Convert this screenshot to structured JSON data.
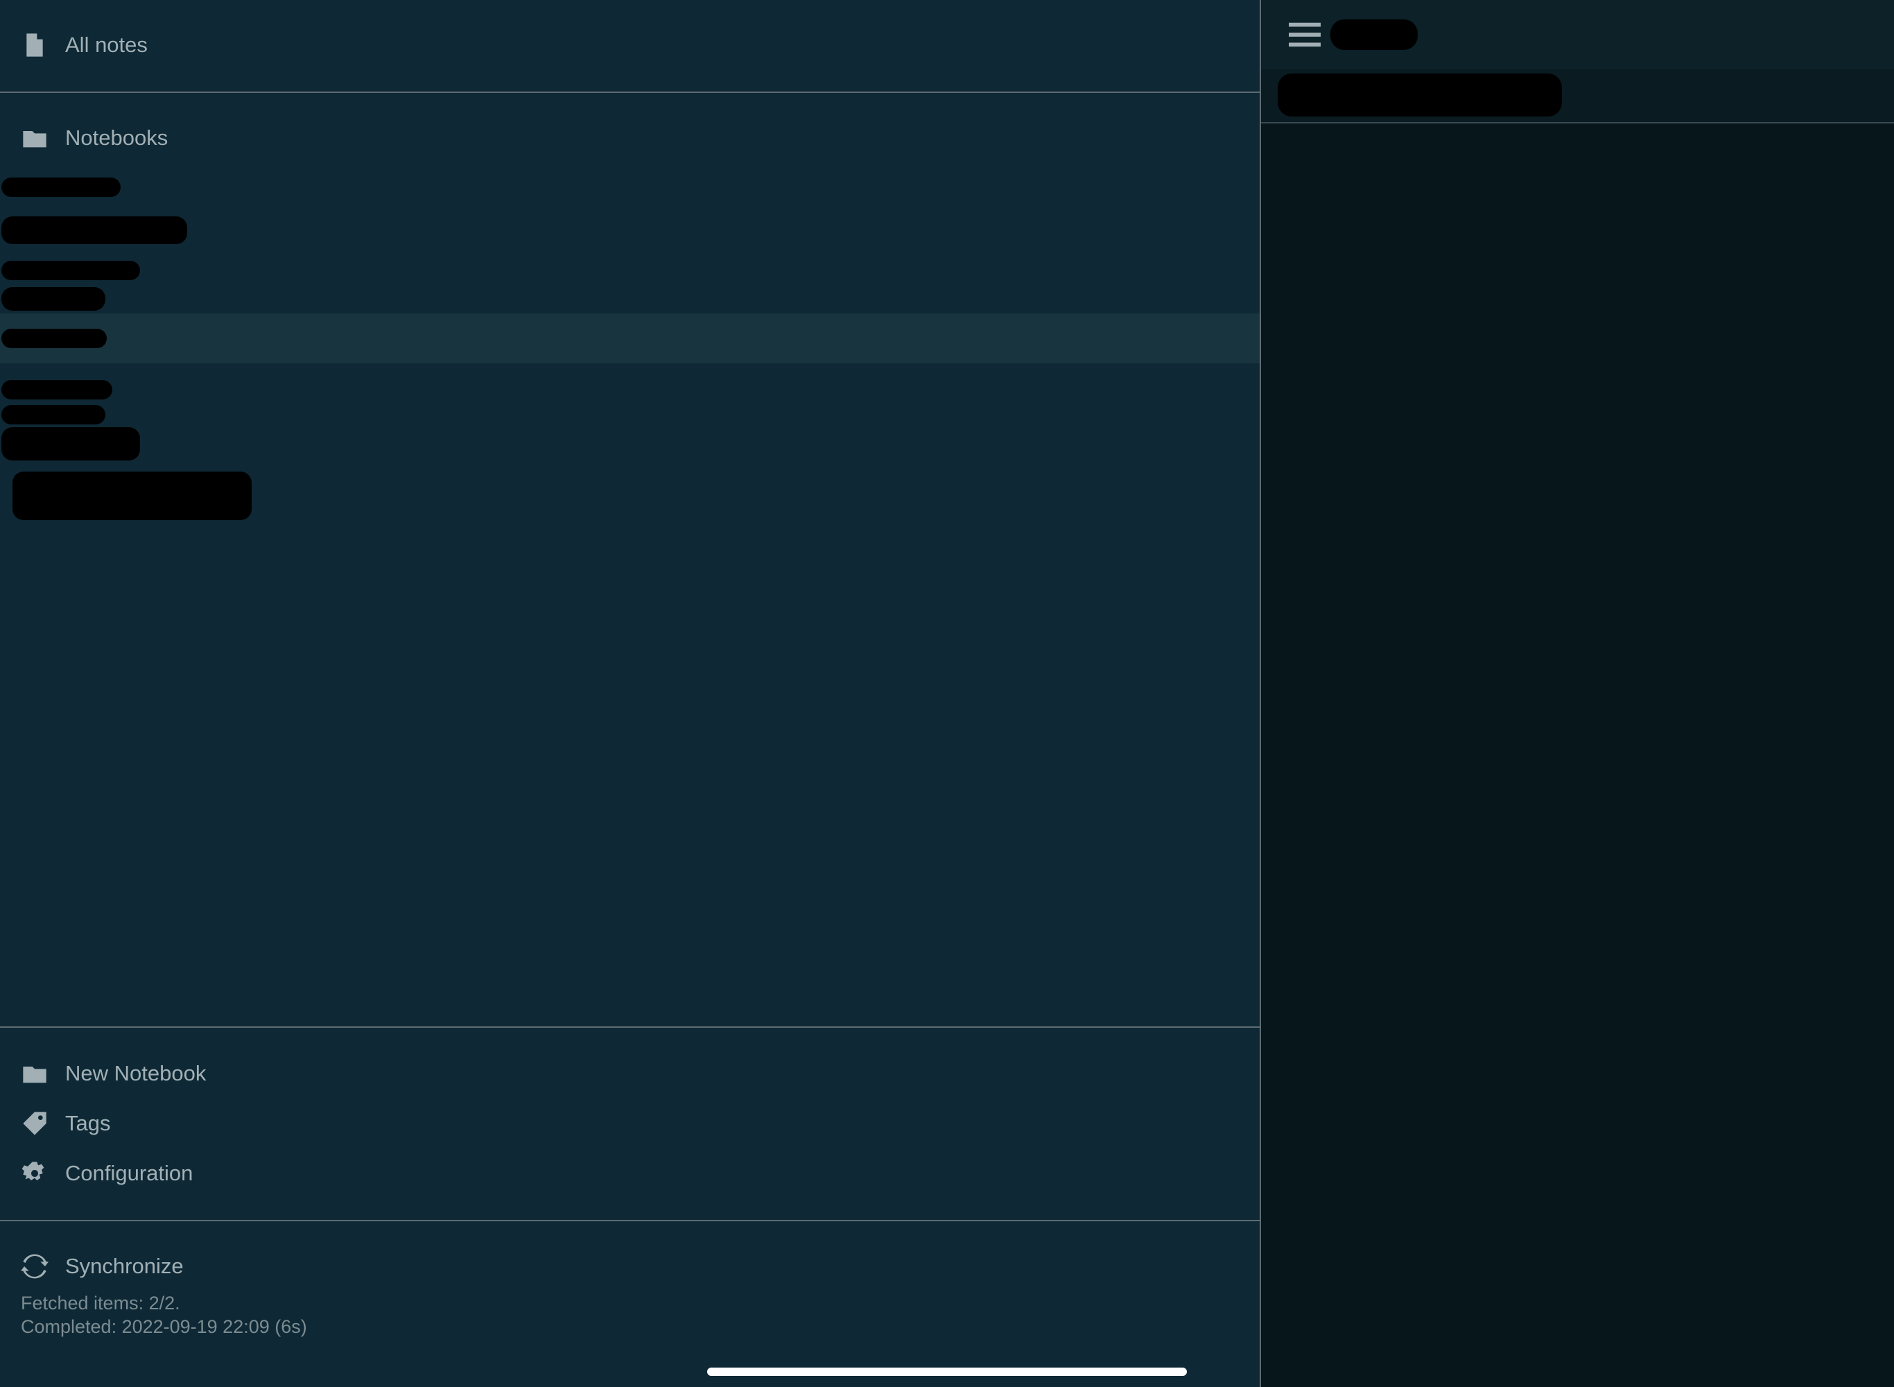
{
  "sidebar": {
    "all_notes_label": "All notes",
    "notebooks_label": "Notebooks",
    "notebook_items_count_visible": 8,
    "actions": {
      "new_notebook": "New Notebook",
      "tags": "Tags",
      "configuration": "Configuration"
    },
    "sync": {
      "label": "Synchronize",
      "fetched": "Fetched items: 2/2.",
      "completed": "Completed: 2022-09-19 22:09 (6s)"
    }
  },
  "main": {
    "header_title_redacted": true,
    "note_title_redacted": true
  },
  "icons": {
    "all_notes": "file-icon",
    "notebooks": "folder-icon",
    "new_notebook": "folder-icon",
    "tags": "tag-icon",
    "configuration": "gear-icon",
    "synchronize": "sync-icon",
    "menu": "hamburger-icon"
  },
  "colors": {
    "sidebar_bg": "#0e2935",
    "main_bg": "#06161b",
    "text": "#a2b0b5",
    "divider": "#5e6c72",
    "selected_row": "#18343f"
  }
}
